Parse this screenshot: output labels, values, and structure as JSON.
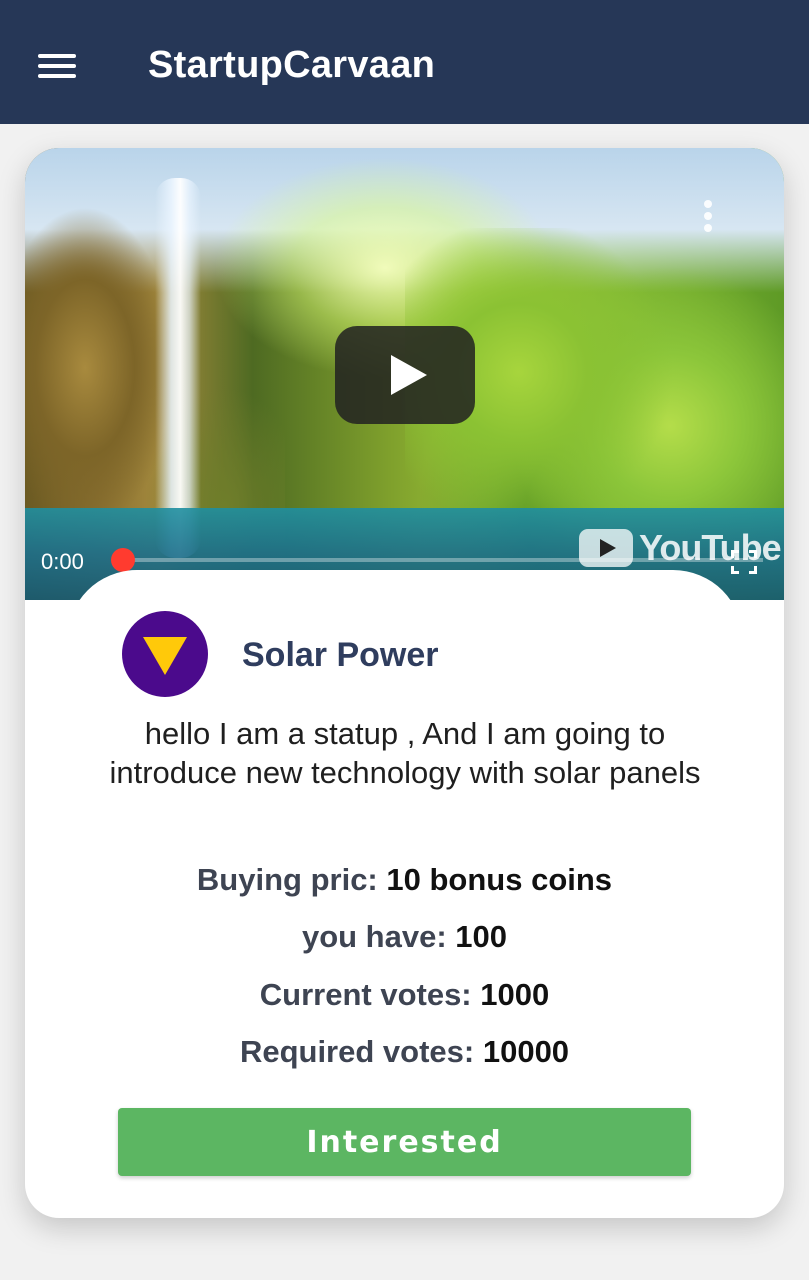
{
  "appbar": {
    "title": "StartupCarvaan",
    "menu_icon": "hamburger-menu-icon"
  },
  "video": {
    "time": "0:00",
    "progress": 0,
    "logo_text": "YouTube",
    "icons": [
      "more-vert-icon",
      "play-icon",
      "youtube-logo-icon",
      "fullscreen-icon"
    ]
  },
  "startup": {
    "name": "Solar Power",
    "logo_icon": "down-triangle-logo-icon",
    "logo_colors": {
      "background": "#4b0a8c",
      "triangle": "#ffc90a"
    },
    "description": "hello I am a statup , And I am going to introduce new technology with solar panels"
  },
  "details": {
    "price_label": "Buying pric:",
    "price_value": "10 bonus coins",
    "have_label": "you have:",
    "have_value": "100",
    "current_votes_label": "Current votes:",
    "current_votes_value": "1000",
    "required_votes_label": "Required votes:",
    "required_votes_value": "10000"
  },
  "action": {
    "interested_label": "Interested",
    "color": "#5cb662"
  },
  "colors": {
    "appbar": "#263757",
    "title_text": "#2f3d5e"
  }
}
